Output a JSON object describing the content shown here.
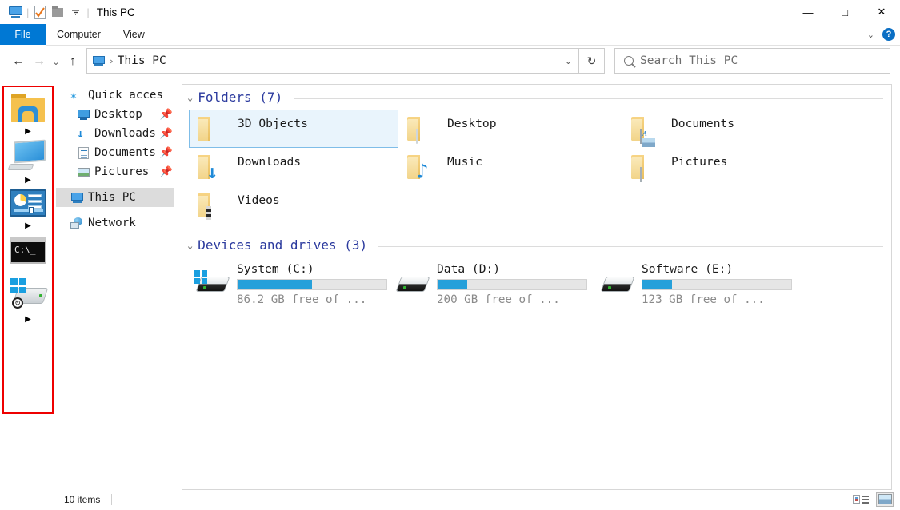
{
  "window": {
    "title": "This PC",
    "quick_access_icons": [
      "this-pc-icon",
      "properties-icon",
      "new-folder-icon",
      "qat-dropdown-icon"
    ],
    "controls": {
      "minimize": "—",
      "maximize": "□",
      "close": "✕"
    }
  },
  "ribbon": {
    "tabs": [
      {
        "label": "File",
        "active": true
      },
      {
        "label": "Computer",
        "active": false
      },
      {
        "label": "View",
        "active": false
      }
    ],
    "collapse_label": "⌄",
    "help_label": "?"
  },
  "addressbar": {
    "back": "←",
    "forward": "→",
    "recent": "⌄",
    "up": "↑",
    "breadcrumb_icon": "this-pc-icon",
    "breadcrumb_sep": "›",
    "path": "This PC",
    "dropdown": "⌄",
    "refresh": "↻"
  },
  "search": {
    "placeholder": "Search This PC",
    "icon": "search-icon"
  },
  "annotation_panel": {
    "border_color": "#ee0000",
    "items": [
      {
        "icon": "folder-icon",
        "arrow": "▶"
      },
      {
        "icon": "this-pc-monitor-icon",
        "arrow": "▶"
      },
      {
        "icon": "control-panel-icon",
        "arrow": "▶"
      },
      {
        "icon": "command-prompt-icon",
        "arrow": ""
      },
      {
        "icon": "windows-drive-icon",
        "arrow": "▶"
      }
    ]
  },
  "navtree": {
    "items": [
      {
        "label": "Quick acces",
        "icon": "star-pin-icon",
        "pin": "",
        "indent": false,
        "selected": false
      },
      {
        "label": "Desktop",
        "icon": "desktop-icon",
        "pin": "📌",
        "indent": true,
        "selected": false
      },
      {
        "label": "Downloads",
        "icon": "downloads-icon",
        "pin": "📌",
        "indent": true,
        "selected": false
      },
      {
        "label": "Documents",
        "icon": "documents-icon",
        "pin": "📌",
        "indent": true,
        "selected": false
      },
      {
        "label": "Pictures",
        "icon": "pictures-icon",
        "pin": "📌",
        "indent": true,
        "selected": false
      },
      {
        "label": "This PC",
        "icon": "this-pc-icon",
        "pin": "",
        "indent": false,
        "selected": true
      },
      {
        "label": "Network",
        "icon": "network-icon",
        "pin": "",
        "indent": false,
        "selected": false
      }
    ]
  },
  "content": {
    "folders_group": {
      "chevron": "⌄",
      "title": "Folders (7)"
    },
    "folders": [
      {
        "label": "3D Objects",
        "icon": "folder-3d-objects-icon",
        "selected": true
      },
      {
        "label": "Desktop",
        "icon": "folder-desktop-icon",
        "selected": false
      },
      {
        "label": "Documents",
        "icon": "folder-documents-icon",
        "selected": false
      },
      {
        "label": "Downloads",
        "icon": "folder-downloads-icon",
        "selected": false
      },
      {
        "label": "Music",
        "icon": "folder-music-icon",
        "selected": false
      },
      {
        "label": "Pictures",
        "icon": "folder-pictures-icon",
        "selected": false
      },
      {
        "label": "Videos",
        "icon": "folder-videos-icon",
        "selected": false
      }
    ],
    "devices_group": {
      "chevron": "⌄",
      "title": "Devices and drives (3)"
    },
    "drives": [
      {
        "name": "System (C:)",
        "free": "86.2 GB free of ...",
        "used_percent": 50,
        "icon": "windows-drive-icon"
      },
      {
        "name": "Data (D:)",
        "free": "200 GB free of  ...",
        "used_percent": 20,
        "icon": "drive-icon"
      },
      {
        "name": "Software (E:)",
        "free": "123 GB free of  ...",
        "used_percent": 20,
        "icon": "drive-icon"
      }
    ],
    "bar_color": "#26a0da"
  },
  "statusbar": {
    "item_count": "10 items",
    "views": [
      {
        "icon": "details-view-icon",
        "active": false
      },
      {
        "icon": "large-icons-view-icon",
        "active": true
      }
    ]
  }
}
